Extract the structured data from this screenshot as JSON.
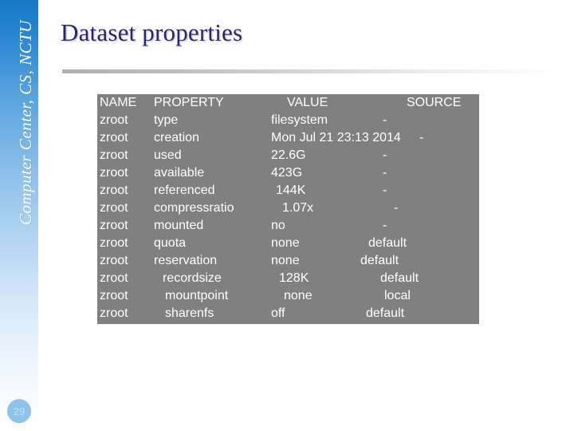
{
  "slide": {
    "title": "Dataset properties",
    "page_number": "29",
    "sidebar_text": "Computer Center, CS, NCTU",
    "accent_blue": "#1278c8",
    "title_color": "#262673",
    "table_background": "#808080",
    "table_text_color": "#ffffff"
  },
  "table": {
    "headers": {
      "name": "NAME",
      "property": "PROPERTY",
      "value": "VALUE",
      "source": "SOURCE"
    },
    "rows": [
      {
        "name": "zroot",
        "property": "type",
        "value": "filesystem",
        "source": "-"
      },
      {
        "name": "zroot",
        "property": "creation",
        "value": "Mon Jul 21 23:13 2014",
        "source": "-"
      },
      {
        "name": "zroot",
        "property": "used",
        "value": "22.6G",
        "source": "-"
      },
      {
        "name": "zroot",
        "property": "available",
        "value": "423G",
        "source": "-"
      },
      {
        "name": "zroot",
        "property": "referenced",
        "value": "144K",
        "source": "-"
      },
      {
        "name": "zroot",
        "property": "compressratio",
        "value": "1.07x",
        "source": "-"
      },
      {
        "name": "zroot",
        "property": "mounted",
        "value": "no",
        "source": "-"
      },
      {
        "name": "zroot",
        "property": "quota",
        "value": "none",
        "source": "default"
      },
      {
        "name": "zroot",
        "property": "reservation",
        "value": "none",
        "source": "default"
      },
      {
        "name": "zroot",
        "property": "recordsize",
        "value": "128K",
        "source": "default"
      },
      {
        "name": "zroot",
        "property": "mountpoint",
        "value": "none",
        "source": "local"
      },
      {
        "name": "zroot",
        "property": "sharenfs",
        "value": "off",
        "source": "default"
      }
    ]
  }
}
